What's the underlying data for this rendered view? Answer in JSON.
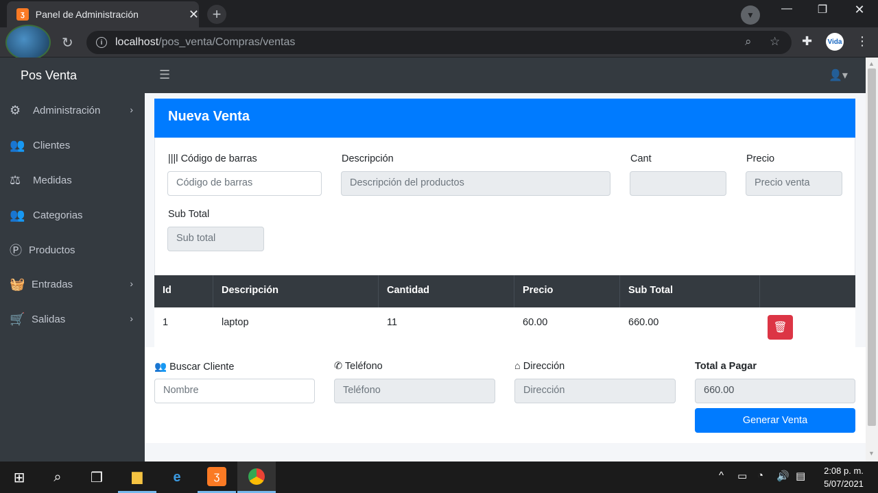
{
  "browser": {
    "tab_title": "Panel de Administración",
    "url_host": "localhost",
    "url_path": "/pos_venta/Compras/ventas"
  },
  "app": {
    "brand": "Pos Venta"
  },
  "sidebar": {
    "items": [
      {
        "label": "Administración",
        "icon": "gears-icon",
        "has_children": true
      },
      {
        "label": "Clientes",
        "icon": "users-icon",
        "has_children": false
      },
      {
        "label": "Medidas",
        "icon": "balance-scale-icon",
        "has_children": false
      },
      {
        "label": "Categorias",
        "icon": "users-icon",
        "has_children": false
      },
      {
        "label": "Productos",
        "icon": "product-p-icon",
        "has_children": false
      },
      {
        "label": "Entradas",
        "icon": "basket-icon",
        "has_children": true
      },
      {
        "label": "Salidas",
        "icon": "cart-icon",
        "has_children": true
      }
    ]
  },
  "form": {
    "title": "Nueva Venta",
    "barcode_label": "Código de barras",
    "barcode_placeholder": "Código de barras",
    "description_label": "Descripción",
    "description_placeholder": "Descripción del productos",
    "qty_label": "Cant",
    "price_label": "Precio",
    "price_placeholder": "Precio venta",
    "subtotal_label": "Sub Total",
    "subtotal_placeholder": "Sub total"
  },
  "table": {
    "headers": [
      "Id",
      "Descripción",
      "Cantidad",
      "Precio",
      "Sub Total"
    ],
    "rows": [
      {
        "id": "1",
        "description": "laptop",
        "quantity": "11",
        "price": "60.00",
        "subtotal": "660.00"
      }
    ]
  },
  "client": {
    "search_label": "Buscar Cliente",
    "search_placeholder": "Nombre",
    "phone_label": "Teléfono",
    "phone_placeholder": "Teléfono",
    "address_label": "Dirección",
    "address_placeholder": "Dirección",
    "total_label": "Total a Pagar",
    "total_value": "660.00",
    "generate_button": "Generar Venta"
  },
  "taskbar": {
    "time": "2:08 p. m.",
    "date": "5/07/2021"
  },
  "colors": {
    "primary": "#007bff",
    "danger": "#dc3545",
    "dark": "#343a40"
  }
}
